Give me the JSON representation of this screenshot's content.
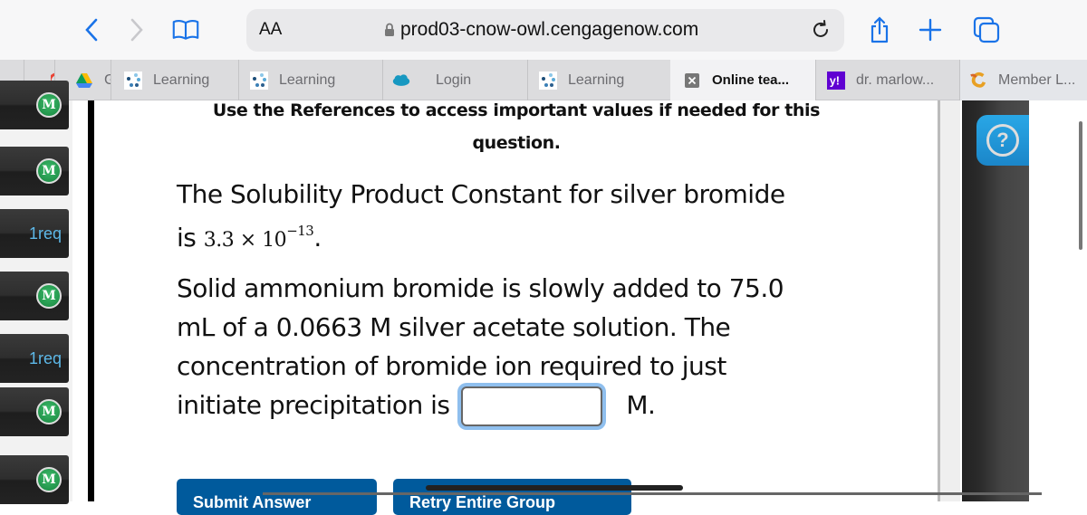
{
  "browser": {
    "text_size_label": "AA",
    "url": "prod03-cnow-owl.cengagenow.com",
    "tabs": [
      {
        "label": "",
        "icon": "google-icon"
      },
      {
        "label": "G",
        "icon": "google-drive-icon"
      },
      {
        "label": "Learning",
        "icon": "cengage-learning-icon"
      },
      {
        "label": "Learning",
        "icon": "cengage-learning-icon"
      },
      {
        "label": "Login",
        "icon": "salesforce-cloud-icon"
      },
      {
        "label": "Learning",
        "icon": "cengage-learning-icon"
      },
      {
        "label": "Online tea...",
        "icon": "close-box-icon",
        "active": true
      },
      {
        "label": "dr. marlow...",
        "icon": "yahoo-icon"
      },
      {
        "label": "Member L...",
        "icon": "member-logo-icon"
      }
    ]
  },
  "left_panel": {
    "items": [
      {
        "type": "mastered",
        "badge": "M"
      },
      {
        "type": "mastered",
        "badge": "M"
      },
      {
        "type": "required",
        "label": "1req"
      },
      {
        "type": "mastered",
        "badge": "M"
      },
      {
        "type": "required",
        "label": "1req"
      },
      {
        "type": "mastered",
        "badge": "M"
      },
      {
        "type": "mastered",
        "badge": "M"
      }
    ]
  },
  "question": {
    "references_note_line1": "Use the References to access important values if needed for this",
    "references_note_line2": "question.",
    "ksp_line1": "The Solubility Product Constant for silver bromide",
    "ksp_prefix": "is",
    "ksp_mantissa": "3.3 × 10",
    "ksp_exponent": "−13",
    "ksp_suffix": ".",
    "problem_line1": "Solid ammonium bromide is slowly added to 75.0",
    "problem_line2": "mL of a 0.0663 M silver acetate solution. The",
    "problem_line3": "concentration of bromide ion required to just",
    "problem_line4_prefix": "initiate precipitation is",
    "answer_value": "",
    "answer_unit": "M.",
    "submit_button": "Submit Answer",
    "retry_button": "Retry Entire Group"
  },
  "help": {
    "icon": "question-mark-icon"
  },
  "colors": {
    "accent_blue": "#1a73e8",
    "button_blue": "#005a9c",
    "req_text": "#5db8e8",
    "mastery_green": "#17853f",
    "help_blue": "#1b86c9"
  }
}
